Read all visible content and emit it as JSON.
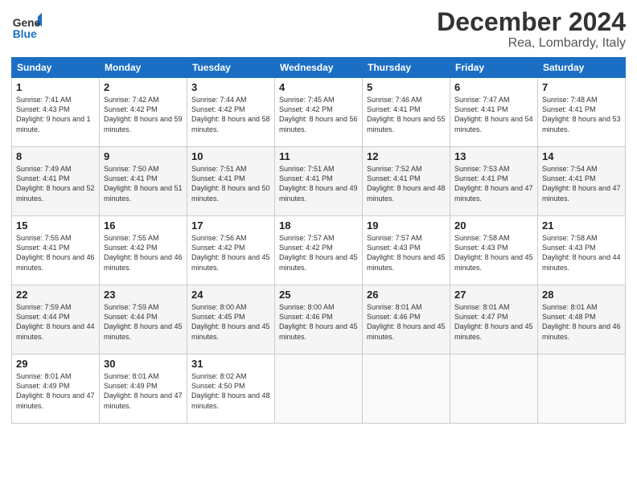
{
  "logo": {
    "line1": "General",
    "line2": "Blue"
  },
  "title": "December 2024",
  "subtitle": "Rea, Lombardy, Italy",
  "days_of_week": [
    "Sunday",
    "Monday",
    "Tuesday",
    "Wednesday",
    "Thursday",
    "Friday",
    "Saturday"
  ],
  "weeks": [
    [
      {
        "day": "1",
        "sunrise": "7:41 AM",
        "sunset": "4:43 PM",
        "daylight": "9 hours and 1 minute."
      },
      {
        "day": "2",
        "sunrise": "7:42 AM",
        "sunset": "4:42 PM",
        "daylight": "8 hours and 59 minutes."
      },
      {
        "day": "3",
        "sunrise": "7:44 AM",
        "sunset": "4:42 PM",
        "daylight": "8 hours and 58 minutes."
      },
      {
        "day": "4",
        "sunrise": "7:45 AM",
        "sunset": "4:42 PM",
        "daylight": "8 hours and 56 minutes."
      },
      {
        "day": "5",
        "sunrise": "7:46 AM",
        "sunset": "4:41 PM",
        "daylight": "8 hours and 55 minutes."
      },
      {
        "day": "6",
        "sunrise": "7:47 AM",
        "sunset": "4:41 PM",
        "daylight": "8 hours and 54 minutes."
      },
      {
        "day": "7",
        "sunrise": "7:48 AM",
        "sunset": "4:41 PM",
        "daylight": "8 hours and 53 minutes."
      }
    ],
    [
      {
        "day": "8",
        "sunrise": "7:49 AM",
        "sunset": "4:41 PM",
        "daylight": "8 hours and 52 minutes."
      },
      {
        "day": "9",
        "sunrise": "7:50 AM",
        "sunset": "4:41 PM",
        "daylight": "8 hours and 51 minutes."
      },
      {
        "day": "10",
        "sunrise": "7:51 AM",
        "sunset": "4:41 PM",
        "daylight": "8 hours and 50 minutes."
      },
      {
        "day": "11",
        "sunrise": "7:51 AM",
        "sunset": "4:41 PM",
        "daylight": "8 hours and 49 minutes."
      },
      {
        "day": "12",
        "sunrise": "7:52 AM",
        "sunset": "4:41 PM",
        "daylight": "8 hours and 48 minutes."
      },
      {
        "day": "13",
        "sunrise": "7:53 AM",
        "sunset": "4:41 PM",
        "daylight": "8 hours and 47 minutes."
      },
      {
        "day": "14",
        "sunrise": "7:54 AM",
        "sunset": "4:41 PM",
        "daylight": "8 hours and 47 minutes."
      }
    ],
    [
      {
        "day": "15",
        "sunrise": "7:55 AM",
        "sunset": "4:41 PM",
        "daylight": "8 hours and 46 minutes."
      },
      {
        "day": "16",
        "sunrise": "7:55 AM",
        "sunset": "4:42 PM",
        "daylight": "8 hours and 46 minutes."
      },
      {
        "day": "17",
        "sunrise": "7:56 AM",
        "sunset": "4:42 PM",
        "daylight": "8 hours and 45 minutes."
      },
      {
        "day": "18",
        "sunrise": "7:57 AM",
        "sunset": "4:42 PM",
        "daylight": "8 hours and 45 minutes."
      },
      {
        "day": "19",
        "sunrise": "7:57 AM",
        "sunset": "4:43 PM",
        "daylight": "8 hours and 45 minutes."
      },
      {
        "day": "20",
        "sunrise": "7:58 AM",
        "sunset": "4:43 PM",
        "daylight": "8 hours and 45 minutes."
      },
      {
        "day": "21",
        "sunrise": "7:58 AM",
        "sunset": "4:43 PM",
        "daylight": "8 hours and 44 minutes."
      }
    ],
    [
      {
        "day": "22",
        "sunrise": "7:59 AM",
        "sunset": "4:44 PM",
        "daylight": "8 hours and 44 minutes."
      },
      {
        "day": "23",
        "sunrise": "7:59 AM",
        "sunset": "4:44 PM",
        "daylight": "8 hours and 45 minutes."
      },
      {
        "day": "24",
        "sunrise": "8:00 AM",
        "sunset": "4:45 PM",
        "daylight": "8 hours and 45 minutes."
      },
      {
        "day": "25",
        "sunrise": "8:00 AM",
        "sunset": "4:46 PM",
        "daylight": "8 hours and 45 minutes."
      },
      {
        "day": "26",
        "sunrise": "8:01 AM",
        "sunset": "4:46 PM",
        "daylight": "8 hours and 45 minutes."
      },
      {
        "day": "27",
        "sunrise": "8:01 AM",
        "sunset": "4:47 PM",
        "daylight": "8 hours and 45 minutes."
      },
      {
        "day": "28",
        "sunrise": "8:01 AM",
        "sunset": "4:48 PM",
        "daylight": "8 hours and 46 minutes."
      }
    ],
    [
      {
        "day": "29",
        "sunrise": "8:01 AM",
        "sunset": "4:49 PM",
        "daylight": "8 hours and 47 minutes."
      },
      {
        "day": "30",
        "sunrise": "8:01 AM",
        "sunset": "4:49 PM",
        "daylight": "8 hours and 47 minutes."
      },
      {
        "day": "31",
        "sunrise": "8:02 AM",
        "sunset": "4:50 PM",
        "daylight": "8 hours and 48 minutes."
      },
      null,
      null,
      null,
      null
    ]
  ],
  "labels": {
    "sunrise": "Sunrise:",
    "sunset": "Sunset:",
    "daylight": "Daylight:"
  }
}
